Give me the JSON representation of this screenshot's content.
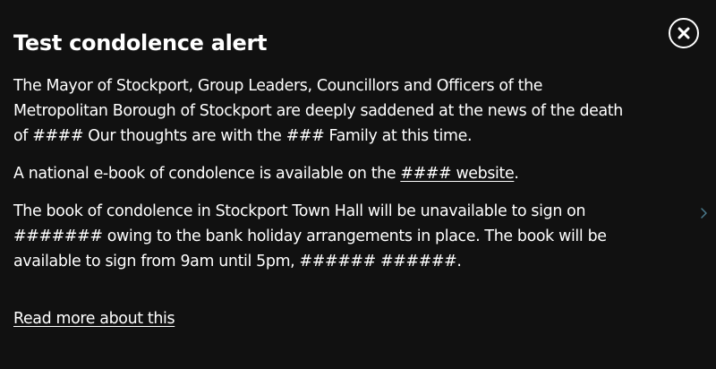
{
  "alert": {
    "title": "Test condolence alert",
    "close_icon": "close-icon",
    "paragraph_1": "The Mayor of Stockport, Group Leaders, Councillors and Officers of the Metropolitan Borough of Stockport are deeply saddened at the news of the death of #### Our thoughts are with the ### Family at this time.",
    "paragraph_2_prefix": "A national e-book of condolence is available on the ",
    "paragraph_2_link": "#### website",
    "paragraph_2_suffix": ".",
    "paragraph_3": "The book of condolence in Stockport Town Hall will be unavailable to sign on ####### owing to the bank holiday arrangements in place. The book will be available to sign from 9am until 5pm, ###### ######.",
    "read_more_link": "Read more about this",
    "next_icon": "chevron-right-icon"
  },
  "colors": {
    "background": "#111111",
    "text": "#ffffff",
    "arrow": "#4a7a8c"
  }
}
